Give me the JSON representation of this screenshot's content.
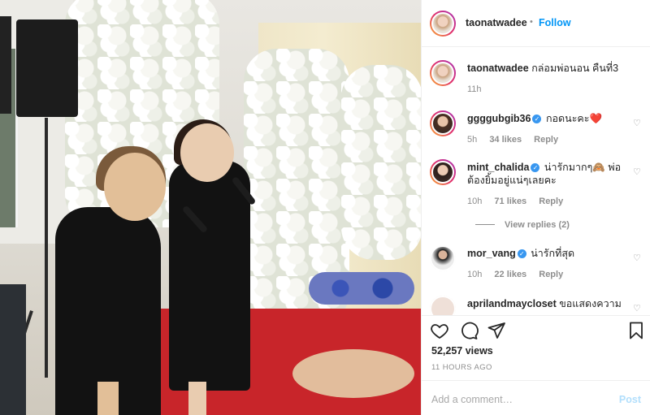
{
  "post": {
    "author": "taonatwadee",
    "follow_label": "Follow",
    "dot": "•",
    "caption": {
      "username": "taonatwadee",
      "text": "กล่อมพ่อนอน คืนที่3",
      "time": "11h"
    },
    "comments": [
      {
        "username": "ggggubgib36",
        "verified": true,
        "text": "กอดนะคะ❤️",
        "time": "5h",
        "likes": "34 likes",
        "reply": "Reply"
      },
      {
        "username": "mint_chalida",
        "verified": true,
        "text": "น่ารักมากๆ🙈 พ่อต้องยิ้มอยู่แน่ๆเลยคะ",
        "time": "10h",
        "likes": "71 likes",
        "reply": "Reply",
        "view_replies": "View replies (2)"
      },
      {
        "username": "mor_vang",
        "verified": true,
        "text": "น่ารักที่สุด",
        "time": "10h",
        "likes": "22 likes",
        "reply": "Reply"
      },
      {
        "username": "aprilandmaycloset",
        "verified": false,
        "text": "ขอแสดงความ",
        "time": "",
        "likes": "",
        "reply": ""
      }
    ],
    "views": "52,257 views",
    "timestamp": "11 HOURS AGO",
    "comment_placeholder": "Add a comment…",
    "post_label": "Post",
    "icons": [
      "heart-icon",
      "comment-icon",
      "share-icon",
      "bookmark-icon"
    ]
  }
}
